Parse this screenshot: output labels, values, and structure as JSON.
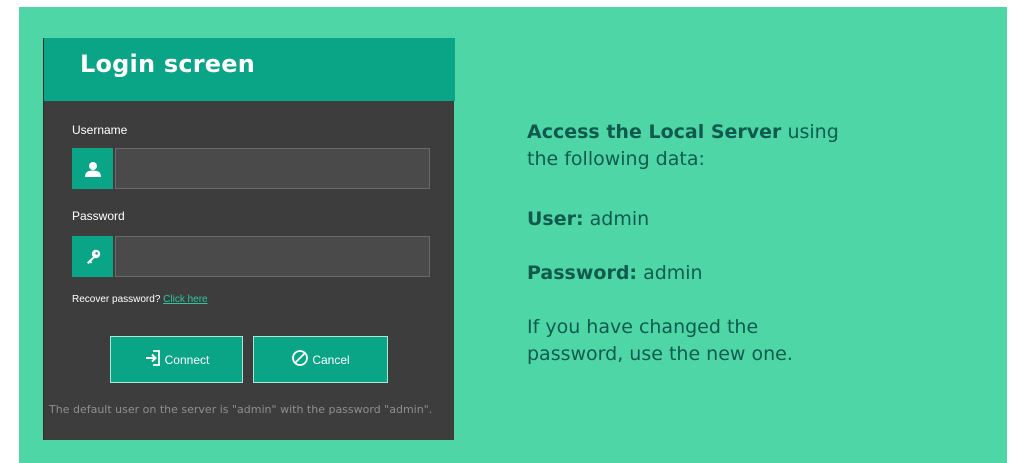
{
  "login": {
    "title": "Login screen",
    "username_label": "Username",
    "username_value": "",
    "password_label": "Password",
    "password_value": "",
    "recover_text": "Recover password?",
    "recover_link": "Click here",
    "connect_label": "Connect",
    "cancel_label": "Cancel",
    "footnote": "The default user on the server is \"admin\" with the password \"admin\"."
  },
  "info": {
    "access_bold": "Access the Local Server",
    "access_rest_1": " using",
    "access_rest_2": "the following data:",
    "user_label": "User:",
    "user_value": " admin",
    "password_label": "Password:",
    "password_value": " admin",
    "note_line_1": "If you have changed the",
    "note_line_2": "password, use the new one."
  },
  "icons": {
    "username": "user-icon",
    "password": "key-icon",
    "connect": "sign-in-icon",
    "cancel": "ban-icon"
  },
  "colors": {
    "background": "#4ed6a7",
    "accent": "#0aa586",
    "panel": "#3d3d3d",
    "info_text": "#0e5b4d"
  }
}
